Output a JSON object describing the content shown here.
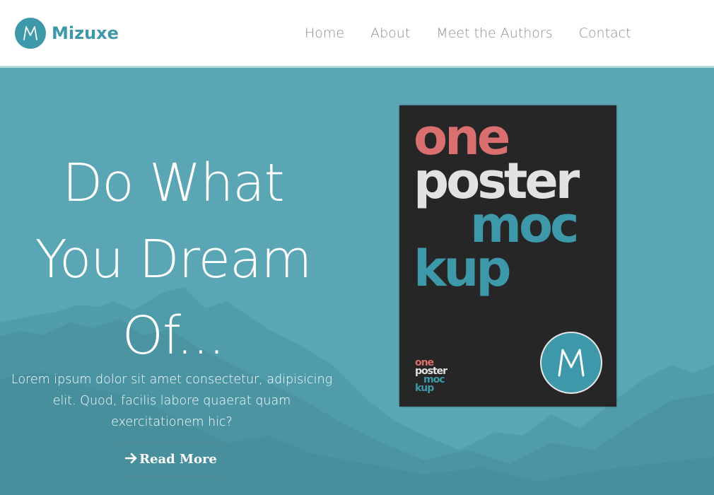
{
  "brand": {
    "name": "Mizuxe",
    "logo_letter": "M",
    "accent_color": "#3d98aa"
  },
  "nav": {
    "items": [
      "Home",
      "About",
      "Meet the Authors",
      "Contact"
    ]
  },
  "hero": {
    "title_lines": [
      "Do What",
      "You Dream",
      "Of..."
    ],
    "body": "Lorem ipsum dolor sit amet consectetur, adipisicing elit. Quod, facilis labore quaerat quam exercitationem hic?",
    "button_label": "Read More",
    "button_icon": "arrow-right-icon"
  },
  "poster": {
    "lines": [
      "one",
      "poster",
      "moc",
      "kup"
    ],
    "line_colors": [
      "#d96f6f",
      "#e2e2e2",
      "#3d98aa",
      "#3d98aa"
    ],
    "badge_letter": "M"
  }
}
